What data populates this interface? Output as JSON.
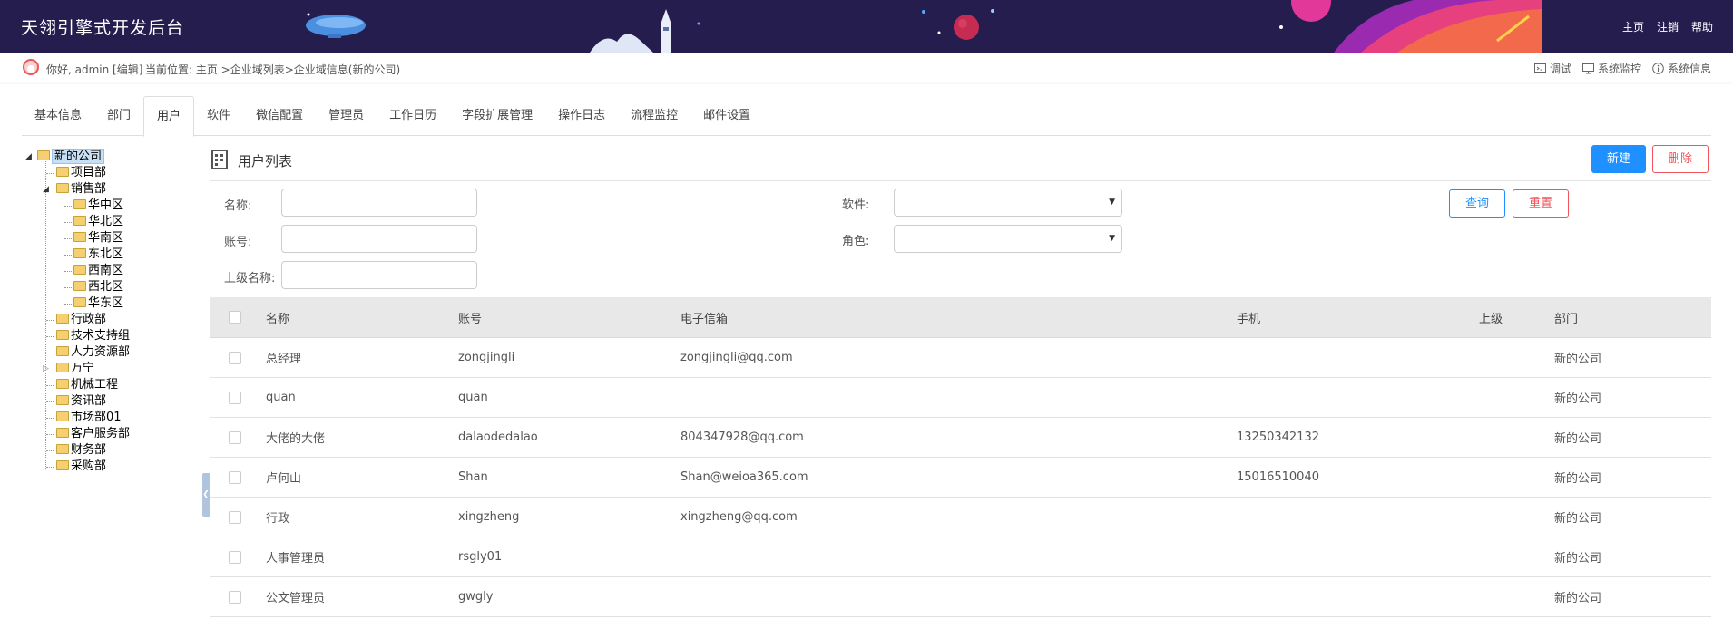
{
  "header": {
    "app_title": "天翎引擎式开发后台",
    "links": [
      "主页",
      "注销",
      "帮助"
    ]
  },
  "infobar": {
    "greeting": "你好, admin [编辑]",
    "breadcrumb": "当前位置: 主页 >企业域列表>企业域信息(新的公司)",
    "tools": [
      {
        "label": "调试",
        "icon": "debug-icon"
      },
      {
        "label": "系统监控",
        "icon": "monitor-icon"
      },
      {
        "label": "系统信息",
        "icon": "info-icon"
      }
    ]
  },
  "tabs": [
    "基本信息",
    "部门",
    "用户",
    "软件",
    "微信配置",
    "管理员",
    "工作日历",
    "字段扩展管理",
    "操作日志",
    "流程监控",
    "邮件设置"
  ],
  "active_tab": "用户",
  "tree": {
    "root": "新的公司",
    "nodes": [
      "项目部",
      "销售部",
      "华中区",
      "华北区",
      "华南区",
      "东北区",
      "西南区",
      "西北区",
      "华东区",
      "行政部",
      "技术支持组",
      "人力资源部",
      "万宁",
      "机械工程",
      "资讯部",
      "市场部01",
      "客户服务部",
      "财务部",
      "采购部"
    ]
  },
  "panel": {
    "title": "用户列表",
    "new_label": "新建",
    "delete_label": "删除"
  },
  "search": {
    "name_label": "名称:",
    "account_label": "账号:",
    "parent_label": "上级名称:",
    "software_label": "软件:",
    "role_label": "角色:",
    "name_value": "",
    "account_value": "",
    "parent_value": "",
    "software_value": "",
    "role_value": "",
    "query_label": "查询",
    "reset_label": "重置"
  },
  "table": {
    "columns": [
      "名称",
      "账号",
      "电子信箱",
      "手机",
      "上级",
      "部门"
    ],
    "rows": [
      {
        "name": "总经理",
        "account": "zongjingli",
        "email": "zongjingli@qq.com",
        "phone": "",
        "superior": "",
        "dept": "新的公司"
      },
      {
        "name": "quan",
        "account": "quan",
        "email": "",
        "phone": "",
        "superior": "",
        "dept": "新的公司"
      },
      {
        "name": "大佬的大佬",
        "account": "dalaodedalao",
        "email": "804347928@qq.com",
        "phone": "13250342132",
        "superior": "",
        "dept": "新的公司"
      },
      {
        "name": "卢何山",
        "account": "Shan",
        "email": "Shan@weioa365.com",
        "phone": "15016510040",
        "superior": "",
        "dept": "新的公司"
      },
      {
        "name": "行政",
        "account": "xingzheng",
        "email": "xingzheng@qq.com",
        "phone": "",
        "superior": "",
        "dept": "新的公司"
      },
      {
        "name": "人事管理员",
        "account": "rsgly01",
        "email": "",
        "phone": "",
        "superior": "",
        "dept": "新的公司"
      },
      {
        "name": "公文管理员",
        "account": "gwgly",
        "email": "",
        "phone": "",
        "superior": "",
        "dept": "新的公司"
      }
    ]
  },
  "colors": {
    "header_bg": "#241d4e",
    "primary": "#1e90ff",
    "danger": "#f0545a",
    "table_head_bg": "#e8e8e8"
  }
}
